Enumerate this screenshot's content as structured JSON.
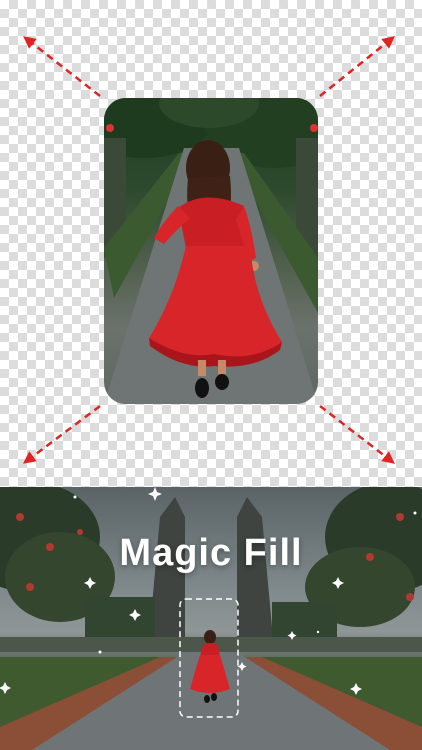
{
  "app": {
    "feature_title": "Magic Fill"
  },
  "colors": {
    "arrow": "#e02424",
    "dress": "#d8252a",
    "checker_light": "#ffffff",
    "checker_dark": "#dcdcdc"
  },
  "icons": [
    "expand-arrow-top-left-icon",
    "expand-arrow-top-right-icon",
    "expand-arrow-bottom-left-icon",
    "expand-arrow-bottom-right-icon",
    "sparkle-icon"
  ]
}
